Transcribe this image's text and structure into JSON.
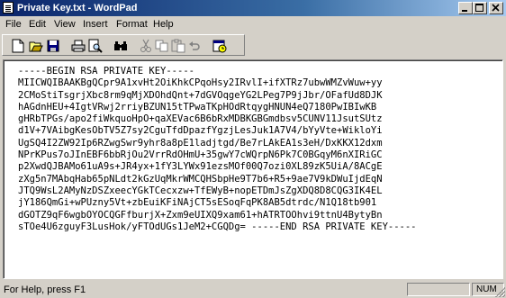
{
  "window": {
    "title": "Private Key.txt - WordPad",
    "controls": [
      "minimize",
      "maximize",
      "close"
    ]
  },
  "menu": {
    "items": [
      "File",
      "Edit",
      "View",
      "Insert",
      "Format",
      "Help"
    ]
  },
  "toolbar": {
    "buttons": [
      "new-document-icon",
      "open-folder-icon",
      "save-icon",
      "print-icon",
      "print-preview-icon",
      "find-icon",
      "cut-icon",
      "copy-icon",
      "paste-icon",
      "undo-icon",
      "insert-date-time-icon"
    ]
  },
  "document": {
    "lines": [
      "-----BEGIN RSA PRIVATE KEY-----",
      "MIICWQIBAAKBgQCpr9A1xvHt2OiKhkCPqoHsy2IRvlI+ifXTRz7ubwWMZvWuw+yy",
      "2CMoStiTsgrjXbc8rm9qMjXDOhdQnt+7dGVOqgeYG2LPeg7P9jJbr/OFafUd8DJK",
      "hAGdnHEU+4IgtVRwj2rriyBZUN15tTPwaTKpHOdRtqygHNUN4eQ7180PwIBIwKB",
      "gHRbTPGs/apo2fiWkquoHpO+qaXEVac6B6bRxMDBKGBGmdbsv5CUNV11JsutSUtz",
      "d1V+7VAibgKesObTV5Z7sy2CguTfdDpazfYgzjLesJuk1A7V4/bYyVte+WikloYi",
      "UgSQ4I2ZW92Ip6RZwgSwr9yhr8a8pE1ladjtgd/Be7rLAkEA1s3eH/DxKKX12dxm",
      "NPrKPus7oJInEBF6bbRjOu2VrrRdOHmU+35gwY7cWQrpN6Pk7C0BGqyM6nXIRiGC",
      "p2XwdQJBAMo61uA9s+JR4yx+1fY3LYWx91ezsMOf00Q7ozi0XL89zK5UiA/8ACgE",
      "zXg5n7MAbqHab65pNLdt2kGzUqMkrWMCQHSbpHe9T7b6+R5+9ae7V9kDWuIjdEqN",
      "JTQ9WsL2AMyNzDSZxeecYGkTCecxzw+TfEWyB+nopETDmJsZgXDQ8D8CQG3IK4EL",
      "jY186QmGi+wPUzny5Vt+zbEuiKFiNAjCT5sESoqFqPK8AB5dtrdc/N1Q18tb901",
      "dGOTZ9qF6wgbOYOCQGFfburjX+Zxm9eUIXQ9xam61+hATRTOOhvi9ttnU4BytyBn",
      "sTOe4U6zguyF3LusHok/yFTOdUGs1JeM2+CGQDg= -----END RSA PRIVATE KEY-----"
    ]
  },
  "status": {
    "help_text": "For Help, press F1",
    "num_indicator": "NUM"
  }
}
